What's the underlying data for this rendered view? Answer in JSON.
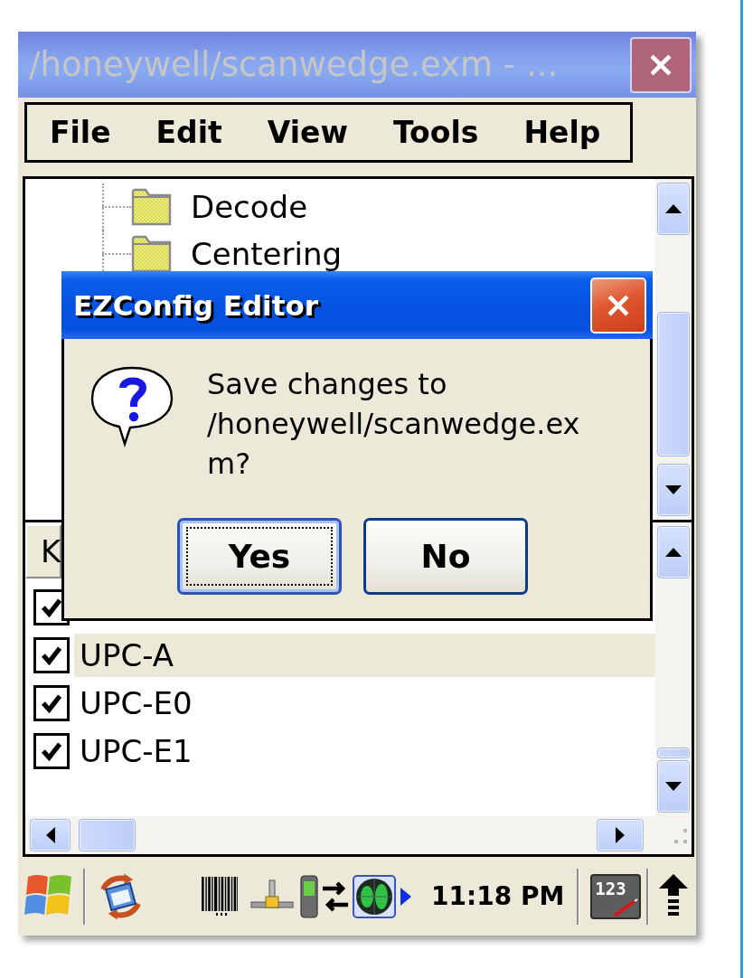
{
  "window": {
    "title": "/honeywell/scanwedge.exm - ..."
  },
  "menu": [
    "File",
    "Edit",
    "View",
    "Tools",
    "Help"
  ],
  "tree": {
    "items": [
      {
        "label": "Decode"
      },
      {
        "label": "Centering"
      }
    ]
  },
  "list": {
    "columns": [
      "K"
    ],
    "rows": [
      {
        "checked": true,
        "selected": false
      },
      {
        "label": "UPC-A",
        "checked": true,
        "selected": true
      },
      {
        "label": "UPC-E0",
        "checked": true,
        "selected": false
      },
      {
        "label": "UPC-E1",
        "checked": true,
        "selected": false
      }
    ]
  },
  "dialog": {
    "title": "EZConfig Editor",
    "message": "Save changes to /honeywell/scanwedge.exm?",
    "buttons": [
      {
        "label": "Yes",
        "focused": true
      },
      {
        "label": "No",
        "focused": false
      }
    ]
  },
  "taskbar": {
    "time": "11:18 PM",
    "input_panel": "123"
  }
}
